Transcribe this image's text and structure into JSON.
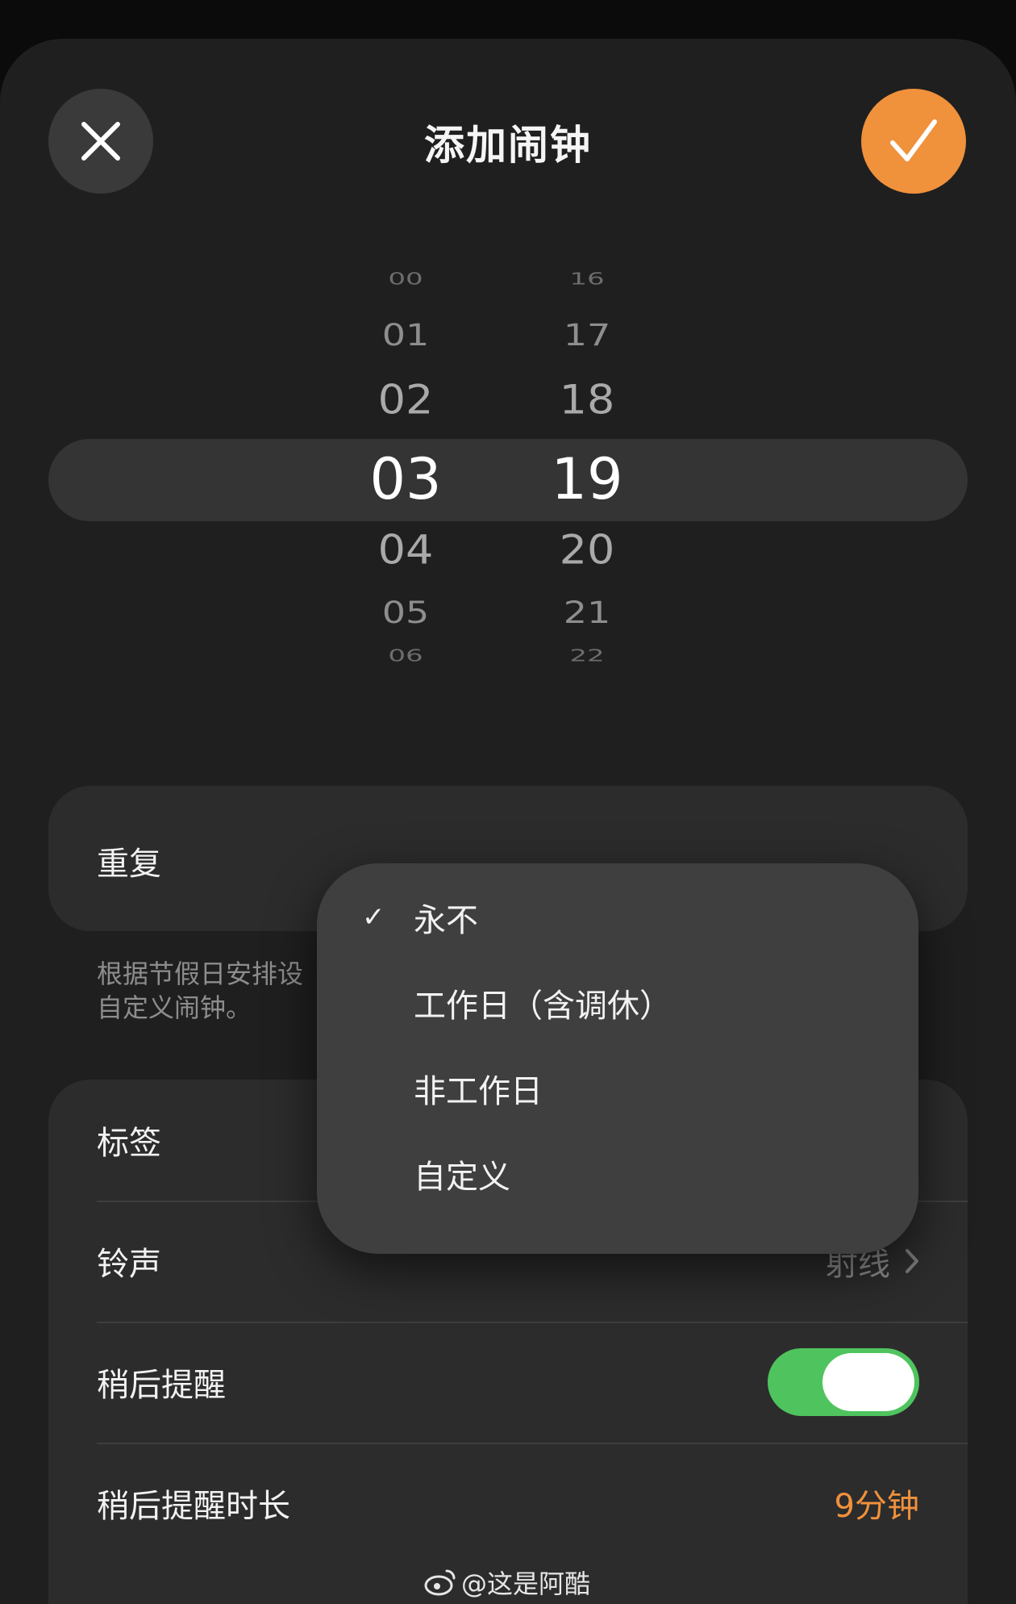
{
  "header": {
    "title": "添加闹钟",
    "close_icon": "close-icon",
    "confirm_icon": "checkmark-icon"
  },
  "picker": {
    "hours": [
      "00",
      "01",
      "02",
      "03",
      "04",
      "05",
      "06"
    ],
    "minutes": [
      "16",
      "17",
      "18",
      "19",
      "20",
      "21",
      "22"
    ],
    "selected_hour": "03",
    "selected_minute": "19"
  },
  "repeat": {
    "label": "重复",
    "hint_line1": "根据节假日安排设",
    "hint_line2": "自定义闹钟。"
  },
  "settings": {
    "label_label": "标签",
    "ringtone_label": "铃声",
    "ringtone_value": "射线",
    "snooze_label": "稍后提醒",
    "snooze_on": true,
    "snooze_duration_label": "稍后提醒时长",
    "snooze_duration_value": "9分钟"
  },
  "menu": {
    "items": [
      {
        "label": "永不",
        "checked": true
      },
      {
        "label": "工作日（含调休）",
        "checked": false
      },
      {
        "label": "非工作日",
        "checked": false
      },
      {
        "label": "自定义",
        "checked": false
      }
    ]
  },
  "watermark": {
    "text": "@这是阿酷"
  },
  "colors": {
    "accent": "#f0913c",
    "toggle_on": "#4fc45e",
    "background": "#1f1f1f"
  }
}
